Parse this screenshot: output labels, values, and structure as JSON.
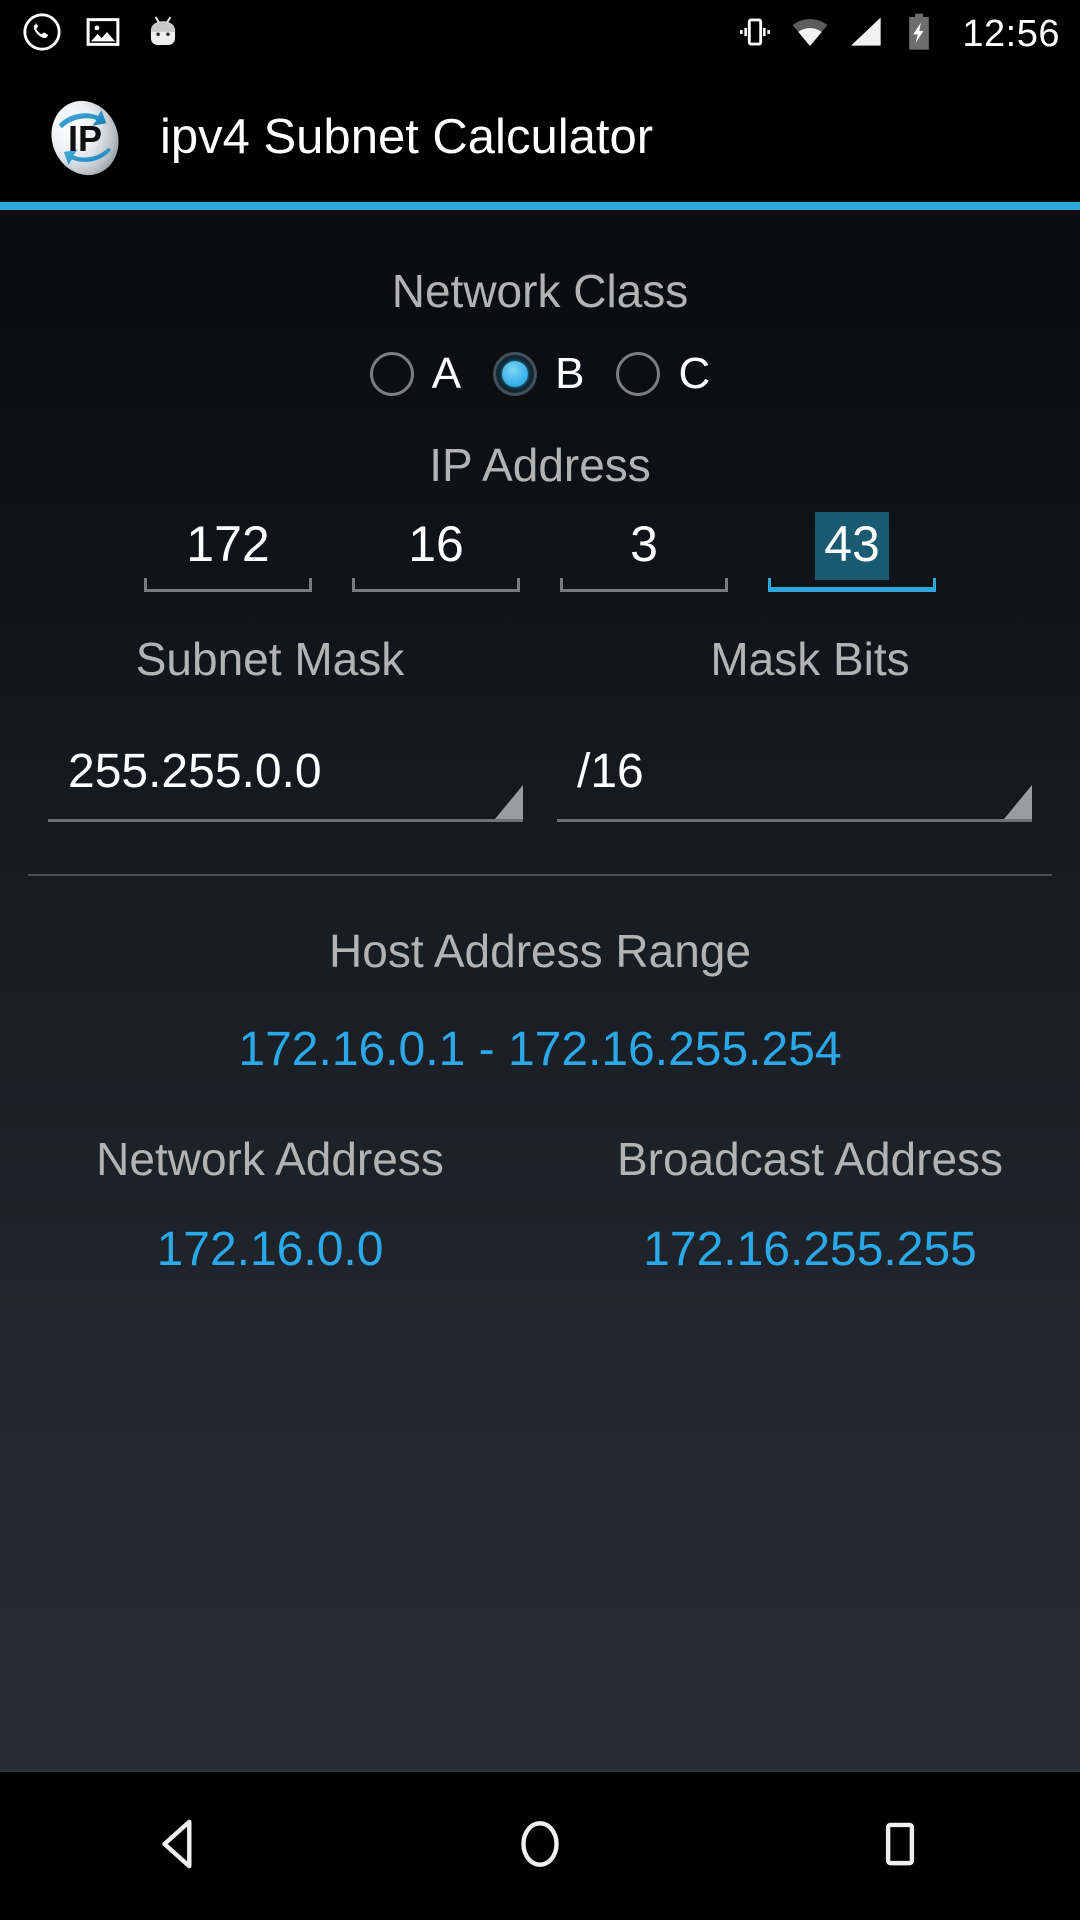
{
  "status_bar": {
    "icons_left": [
      "missed-call-icon",
      "photo-icon",
      "android-head-icon"
    ],
    "icons_right": [
      "vibrate-icon",
      "wifi-icon",
      "cell-signal-icon",
      "battery-charging-icon"
    ],
    "clock": "12:56"
  },
  "action_bar": {
    "app_icon": "ip-globe-icon",
    "title": "ipv4 Subnet Calculator",
    "accent_color": "#2fa8dd"
  },
  "network_class": {
    "label": "Network Class",
    "options": [
      {
        "label": "A",
        "checked": false
      },
      {
        "label": "B",
        "checked": true
      },
      {
        "label": "C",
        "checked": false
      }
    ],
    "selected": "B"
  },
  "ip_address": {
    "label": "IP Address",
    "octets": [
      {
        "value": "172",
        "focused": false,
        "selected": false
      },
      {
        "value": "16",
        "focused": false,
        "selected": false
      },
      {
        "value": "3",
        "focused": false,
        "selected": false
      },
      {
        "value": "43",
        "focused": true,
        "selected": true
      }
    ]
  },
  "subnet_mask": {
    "label": "Subnet Mask",
    "value": "255.255.0.0"
  },
  "mask_bits": {
    "label": "Mask Bits",
    "value": "/16"
  },
  "results": {
    "host_range_label": "Host Address Range",
    "host_range_value": "172.16.0.1 - 172.16.255.254",
    "network_address_label": "Network Address",
    "network_address_value": "172.16.0.0",
    "broadcast_address_label": "Broadcast Address",
    "broadcast_address_value": "172.16.255.255",
    "value_color": "#2aa8e8"
  },
  "nav_bar": {
    "back": "back-icon",
    "home": "home-icon",
    "recents": "recents-icon"
  }
}
